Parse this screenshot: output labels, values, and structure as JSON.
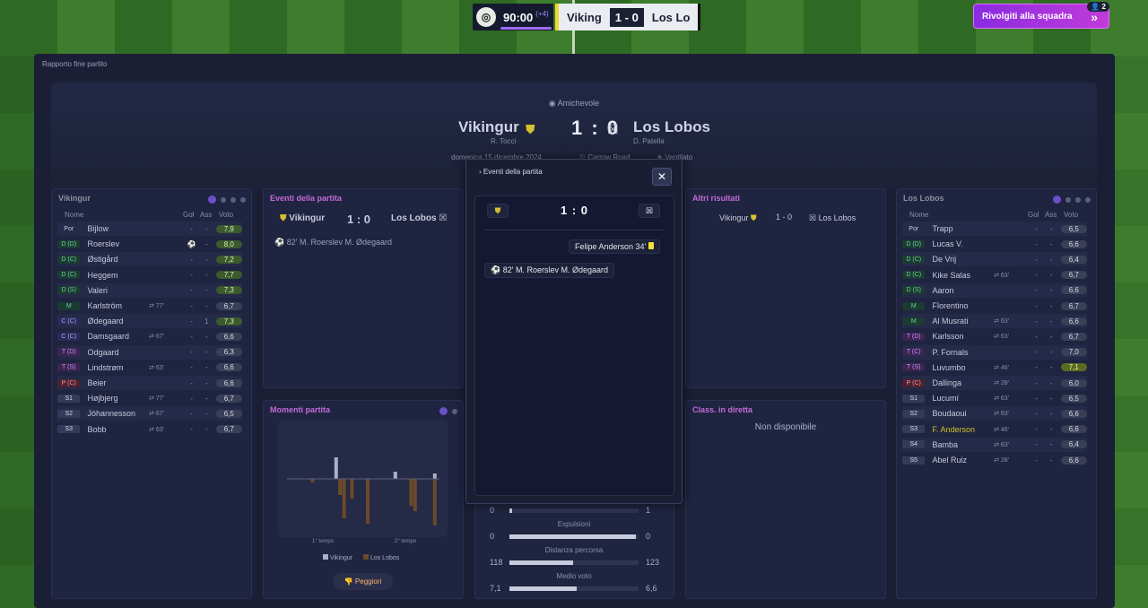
{
  "topbar": {
    "clock": "90:00",
    "added": "(+4)",
    "home": "Viking",
    "score": "1 - 0",
    "away": "Los Lo"
  },
  "squad_button": {
    "label": "Rivolgiti alla squadra",
    "count": "2"
  },
  "window_title": "Rapporto fine partito",
  "header": {
    "competition": "Amichevole",
    "home": "Vikingur",
    "home_coach": "R. Tocci",
    "score": "1 : 0",
    "away": "Los Lobos",
    "away_coach": "D. Patella",
    "date": "domenica 15 dicembre 2024",
    "stadium": "Carrow Road",
    "weather": "Ventilato"
  },
  "columns": {
    "name": "Nome",
    "goals": "Gol",
    "assists": "Ass",
    "rating": "Voto"
  },
  "home_panel": {
    "title": "Vikingur",
    "players": [
      {
        "pos": "Por",
        "name": "Bijlow",
        "sub": "",
        "g": "-",
        "a": "-",
        "r": "7,9",
        "rc": "good"
      },
      {
        "pos": "D (D)",
        "name": "Roerslev",
        "sub": "",
        "g": "⚽",
        "a": "-",
        "r": "8,0",
        "rc": "good"
      },
      {
        "pos": "D (C)",
        "name": "Østigård",
        "sub": "",
        "g": "-",
        "a": "-",
        "r": "7,2",
        "rc": "good"
      },
      {
        "pos": "D (C)",
        "name": "Heggem",
        "sub": "",
        "g": "-",
        "a": "-",
        "r": "7,7",
        "rc": "good"
      },
      {
        "pos": "D (S)",
        "name": "Valeri",
        "sub": "",
        "g": "-",
        "a": "-",
        "r": "7,3",
        "rc": "good"
      },
      {
        "pos": "M",
        "name": "Karlström",
        "sub": "⇄ 77'",
        "g": "-",
        "a": "-",
        "r": "6,7",
        "rc": ""
      },
      {
        "pos": "C (C)",
        "name": "Ødegaard",
        "sub": "",
        "g": "-",
        "a": "1",
        "r": "7,3",
        "rc": "good"
      },
      {
        "pos": "C (C)",
        "name": "Damsgaard",
        "sub": "⇄ 67'",
        "g": "-",
        "a": "-",
        "r": "6,6",
        "rc": ""
      },
      {
        "pos": "T (D)",
        "name": "Odgaard",
        "sub": "",
        "g": "-",
        "a": "-",
        "r": "6,3",
        "rc": ""
      },
      {
        "pos": "T (S)",
        "name": "Lindstrøm",
        "sub": "⇄ 63'",
        "g": "-",
        "a": "-",
        "r": "6,6",
        "rc": ""
      },
      {
        "pos": "P (C)",
        "name": "Beier",
        "sub": "",
        "g": "-",
        "a": "-",
        "r": "6,6",
        "rc": ""
      },
      {
        "pos": "S1",
        "name": "Højbjerg",
        "sub": "⇄ 77'",
        "g": "-",
        "a": "-",
        "r": "6,7",
        "rc": ""
      },
      {
        "pos": "S2",
        "name": "Jóhannesson",
        "sub": "⇄ 67'",
        "g": "-",
        "a": "-",
        "r": "6,5",
        "rc": ""
      },
      {
        "pos": "S3",
        "name": "Bobb",
        "sub": "⇄ 63'",
        "g": "-",
        "a": "-",
        "r": "6,7",
        "rc": ""
      }
    ]
  },
  "away_panel": {
    "title": "Los Lobos",
    "players": [
      {
        "pos": "Por",
        "name": "Trapp",
        "sub": "",
        "g": "-",
        "a": "-",
        "r": "6,5",
        "rc": ""
      },
      {
        "pos": "D (D)",
        "name": "Lucas V.",
        "sub": "",
        "g": "-",
        "a": "-",
        "r": "6,6",
        "rc": ""
      },
      {
        "pos": "D (C)",
        "name": "De Vrij",
        "sub": "",
        "g": "-",
        "a": "-",
        "r": "6,4",
        "rc": ""
      },
      {
        "pos": "D (C)",
        "name": "Kike Salas",
        "sub": "⇄ 63'",
        "g": "-",
        "a": "-",
        "r": "6,7",
        "rc": ""
      },
      {
        "pos": "D (S)",
        "name": "Aaron",
        "sub": "",
        "g": "-",
        "a": "-",
        "r": "6,6",
        "rc": ""
      },
      {
        "pos": "M",
        "name": "Florentino",
        "sub": "",
        "g": "-",
        "a": "-",
        "r": "6,7",
        "rc": ""
      },
      {
        "pos": "M",
        "name": "Al Musrati",
        "sub": "⇄ 63'",
        "g": "-",
        "a": "-",
        "r": "6,6",
        "rc": ""
      },
      {
        "pos": "T (D)",
        "name": "Karlsson",
        "sub": "⇄ 63'",
        "g": "-",
        "a": "-",
        "r": "6,7",
        "rc": ""
      },
      {
        "pos": "T (C)",
        "name": "P. Fornals",
        "sub": "",
        "g": "-",
        "a": "-",
        "r": "7,0",
        "rc": ""
      },
      {
        "pos": "T (S)",
        "name": "Luvumbo",
        "sub": "⇄ 46'",
        "g": "-",
        "a": "-",
        "r": "7,1",
        "rc": "great"
      },
      {
        "pos": "P (C)",
        "name": "Dallinga",
        "sub": "⇄ 28'",
        "g": "-",
        "a": "-",
        "r": "6,0",
        "rc": ""
      },
      {
        "pos": "S1",
        "name": "Lucumí",
        "sub": "⇄ 63'",
        "g": "-",
        "a": "-",
        "r": "6,5",
        "rc": ""
      },
      {
        "pos": "S2",
        "name": "Boudaoui",
        "sub": "⇄ 63'",
        "g": "-",
        "a": "-",
        "r": "6,6",
        "rc": ""
      },
      {
        "pos": "S3",
        "name": "F. Anderson",
        "sub": "⇄ 46'",
        "g": "-",
        "a": "-",
        "r": "6,6",
        "rc": ""
      },
      {
        "pos": "S4",
        "name": "Bamba",
        "sub": "⇄ 63'",
        "g": "-",
        "a": "-",
        "r": "6,4",
        "rc": ""
      },
      {
        "pos": "S5",
        "name": "Abel Ruiz",
        "sub": "⇄ 28'",
        "g": "-",
        "a": "-",
        "r": "6,6",
        "rc": ""
      }
    ]
  },
  "events_panel": {
    "title": "Eventi della partita",
    "home": "Vikingur",
    "score": "1 : 0",
    "away": "Los Lobos",
    "event": "82' M. Roerslev M. Ødegaard"
  },
  "other_results": {
    "title": "Altri risultati",
    "home": "Vikingur",
    "score": "1 - 0",
    "away": "Los Lobos"
  },
  "momentum": {
    "title": "Momenti partita",
    "first_half": "1° tempo",
    "second_half": "2° tempo",
    "legend_home": "Vikingur",
    "legend_away": "Los Lobos",
    "button": "Peggiori"
  },
  "live_table": {
    "title": "Class. in diretta",
    "message": "Non disponibile"
  },
  "modal": {
    "title": "Eventi della partita",
    "score": "1 : 0",
    "yellow": "Felipe Anderson  34'",
    "goal": "82'  M. Roerslev  M. Ødegaard",
    "close": "✕"
  },
  "stats": [
    {
      "label": "",
      "home": "0",
      "away": "1",
      "hf": 0.02
    },
    {
      "label": "Espulsioni",
      "home": "0",
      "away": "0",
      "hf": 0.98
    },
    {
      "label": "Distanza percorsa",
      "home": "118",
      "away": "123",
      "hf": 0.49
    },
    {
      "label": "Medio voto",
      "home": "7,1",
      "away": "6,6",
      "hf": 0.52
    }
  ],
  "colors": {
    "accent": "#8a2be2",
    "home_title": "#8e8f9c",
    "panel_title": "#c26bd8"
  }
}
